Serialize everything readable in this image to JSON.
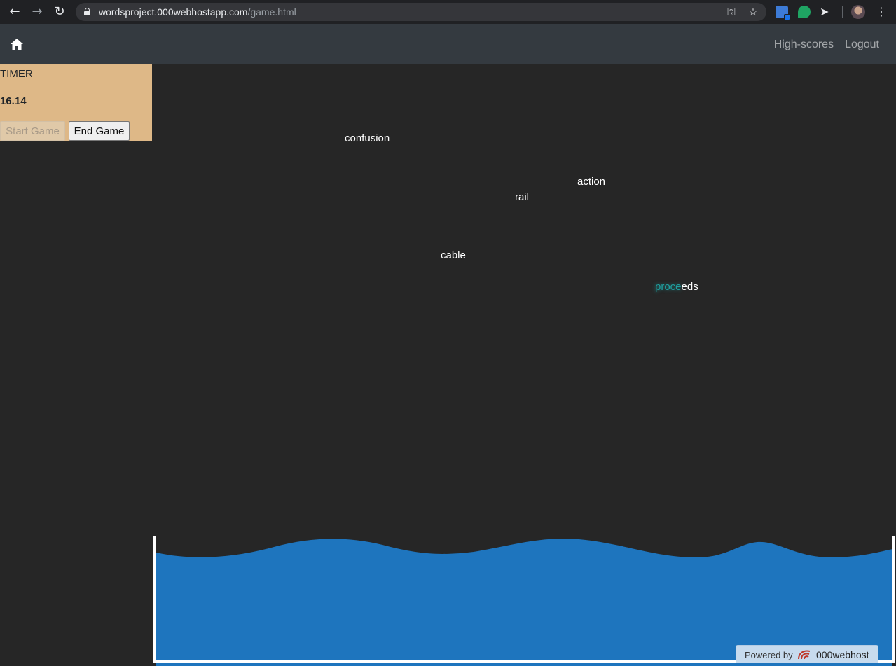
{
  "browser": {
    "url_host": "wordsproject.000webhostapp.com",
    "url_path": "/game.html",
    "back_icon": "arrow-left-icon",
    "forward_icon": "arrow-right-icon",
    "reload_icon": "reload-icon"
  },
  "navbar": {
    "home_icon": "home-icon",
    "links": [
      {
        "label": "High-scores"
      },
      {
        "label": "Logout"
      }
    ]
  },
  "game": {
    "timer_label": "TIMER",
    "timer_value": "16.14",
    "start_button": "Start Game",
    "end_button": "End Game",
    "falling_words": [
      {
        "text": "confusion",
        "typed": "",
        "rest": "confusion"
      },
      {
        "text": "action",
        "typed": "",
        "rest": "action"
      },
      {
        "text": "rail",
        "typed": "",
        "rest": "rail"
      },
      {
        "text": "cable",
        "typed": "",
        "rest": "cable"
      },
      {
        "text": "proceeds",
        "typed": "proce",
        "rest": "eds"
      }
    ],
    "colors": {
      "panel": "#deb887",
      "water": "#1e75be",
      "typed_highlight": "#1fa0a0",
      "background": "#262626"
    }
  },
  "footer_badge": {
    "prefix": "Powered by",
    "brand": "000webhost"
  }
}
